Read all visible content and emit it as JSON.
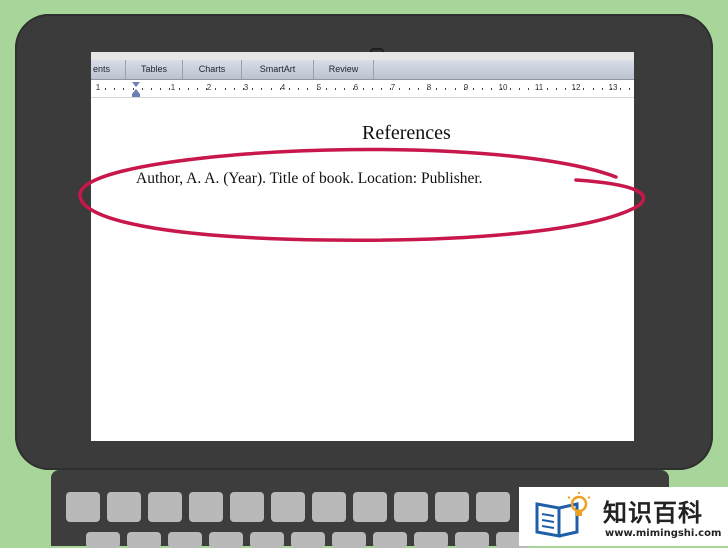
{
  "ribbon": {
    "tabs": [
      {
        "label": "ents"
      },
      {
        "label": "Tables"
      },
      {
        "label": "Charts"
      },
      {
        "label": "SmartArt"
      },
      {
        "label": "Review"
      }
    ]
  },
  "ruler": {
    "marks": [
      "1",
      "1",
      "2",
      "3",
      "4",
      "5",
      "6",
      "7",
      "8",
      "9",
      "10",
      "11",
      "12",
      "13"
    ]
  },
  "document": {
    "heading": "References",
    "reference_entry": "Author, A. A. (Year). Title of book. Location: Publisher."
  },
  "annotation": {
    "color": "#c8174a"
  },
  "watermark": {
    "title": "知识百科",
    "url": "www.mimingshi.com"
  }
}
